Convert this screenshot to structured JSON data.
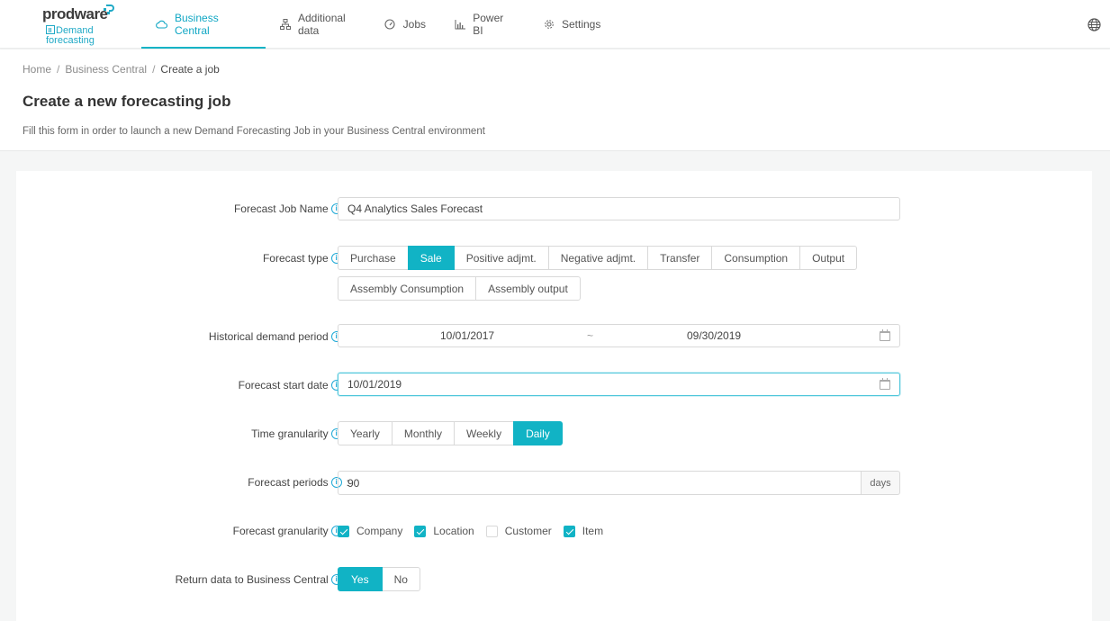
{
  "brand": {
    "name": "prodware",
    "product_line1": "Demand",
    "product_line2": "forecasting"
  },
  "nav": {
    "items": [
      {
        "label": "Business Central",
        "icon": "cloud-icon",
        "active": true
      },
      {
        "label": "Additional data",
        "icon": "sitemap-icon",
        "active": false
      },
      {
        "label": "Jobs",
        "icon": "dashboard-icon",
        "active": false
      },
      {
        "label": "Power BI",
        "icon": "bar-chart-icon",
        "active": false
      },
      {
        "label": "Settings",
        "icon": "gear-icon",
        "active": false
      }
    ],
    "language_icon": "globe-icon"
  },
  "breadcrumb": {
    "items": [
      "Home",
      "Business Central",
      "Create a job"
    ],
    "separator": "/"
  },
  "page": {
    "title": "Create a new forecasting job",
    "subtitle": "Fill this form in order to launch a new Demand Forecasting Job in your Business Central environment"
  },
  "form": {
    "info_glyph": "i",
    "colon": ":",
    "job_name": {
      "label": "Forecast Job Name",
      "value": "Q4 Analytics Sales Forecast"
    },
    "forecast_type": {
      "label": "Forecast type",
      "options_row1": [
        "Purchase",
        "Sale",
        "Positive adjmt.",
        "Negative adjmt.",
        "Transfer",
        "Consumption",
        "Output"
      ],
      "options_row2": [
        "Assembly Consumption",
        "Assembly output"
      ],
      "selected": "Sale"
    },
    "historical_period": {
      "label": "Historical demand period",
      "start": "10/01/2017",
      "separator": "~",
      "end": "09/30/2019"
    },
    "start_date": {
      "label": "Forecast start date",
      "value": "10/01/2019"
    },
    "time_granularity": {
      "label": "Time granularity",
      "options": [
        "Yearly",
        "Monthly",
        "Weekly",
        "Daily"
      ],
      "selected": "Daily"
    },
    "forecast_periods": {
      "label": "Forecast periods",
      "value": "90",
      "unit": "days"
    },
    "forecast_granularity": {
      "label": "Forecast granularity",
      "options": [
        {
          "label": "Company",
          "checked": true
        },
        {
          "label": "Location",
          "checked": true
        },
        {
          "label": "Customer",
          "checked": false
        },
        {
          "label": "Item",
          "checked": true
        }
      ]
    },
    "return_data": {
      "label": "Return data to Business Central",
      "options": [
        "Yes",
        "No"
      ],
      "selected": "Yes"
    }
  },
  "colors": {
    "accent": "#11b3c5",
    "info": "#1fa9d6"
  }
}
